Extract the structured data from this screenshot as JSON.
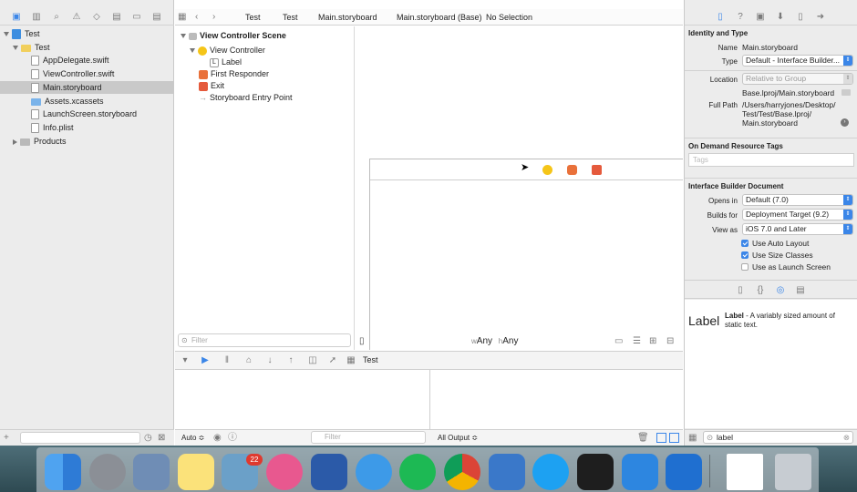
{
  "navigator": {
    "items": [
      {
        "label": "Test",
        "kind": "project"
      },
      {
        "label": "Test",
        "kind": "folder"
      },
      {
        "label": "AppDelegate.swift",
        "kind": "file"
      },
      {
        "label": "ViewController.swift",
        "kind": "file"
      },
      {
        "label": "Main.storyboard",
        "kind": "file",
        "selected": true
      },
      {
        "label": "Assets.xcassets",
        "kind": "file"
      },
      {
        "label": "LaunchScreen.storyboard",
        "kind": "file"
      },
      {
        "label": "Info.plist",
        "kind": "file"
      },
      {
        "label": "Products",
        "kind": "folder"
      }
    ]
  },
  "jumpbar": {
    "crumbs": [
      "Test",
      "Test",
      "Main.storyboard",
      "Main.storyboard (Base)",
      "No Selection"
    ]
  },
  "outline": {
    "scene": "View Controller Scene",
    "items": [
      "View Controller",
      "Label",
      "First Responder",
      "Exit",
      "Storyboard Entry Point"
    ],
    "label_letter": "L",
    "filter_placeholder": "Filter"
  },
  "canvas": {
    "size_w_prefix": "w",
    "size_w": "Any",
    "size_h_prefix": "h",
    "size_h": "Any"
  },
  "debug": {
    "target": "Test",
    "auto": "Auto ≎",
    "filter_placeholder": "Filter",
    "output": "All Output ≎"
  },
  "inspector": {
    "identity_title": "Identity and Type",
    "name_label": "Name",
    "name_value": "Main.storyboard",
    "type_label": "Type",
    "type_value": "Default - Interface Builder...",
    "location_label": "Location",
    "location_value": "Relative to Group",
    "location_path": "Base.lproj/Main.storyboard",
    "fullpath_label": "Full Path",
    "fullpath_value": [
      "/Users/harryjones/Desktop/",
      "Test/Test/Base.lproj/",
      "Main.storyboard"
    ],
    "odr_title": "On Demand Resource Tags",
    "tags_placeholder": "Tags",
    "ibdoc_title": "Interface Builder Document",
    "opens_label": "Opens in",
    "opens_value": "Default (7.0)",
    "builds_label": "Builds for",
    "builds_value": "Deployment Target (9.2)",
    "viewas_label": "View as",
    "viewas_value": "iOS 7.0 and Later",
    "check_autolayout": "Use Auto Layout",
    "check_sizeclasses": "Use Size Classes",
    "check_launch": "Use as Launch Screen"
  },
  "library": {
    "item_name": "Label",
    "item_title": "Label",
    "item_desc": "- A variably sized amount of static text.",
    "filter_value": "label"
  },
  "dock": {
    "mail_badge": "22"
  },
  "colors": {
    "selection": "#c9c9c9",
    "accent": "#3b86e8",
    "vc_yellow": "#f5c518",
    "first_responder": "#e9713a",
    "exit": "#e55a3c"
  }
}
